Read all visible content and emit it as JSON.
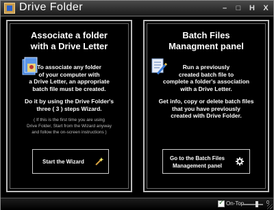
{
  "window": {
    "title": "Drive Folder",
    "controls": [
      "–",
      "□",
      "H",
      "X"
    ]
  },
  "left_panel": {
    "title": "Associate a folder\nwith a Drive Letter",
    "icon": "folder-drive-icon",
    "body": "To associate any folder\nof your computer with\na Drive Letter, an appropriate\nbatch file must be created.",
    "body2": "Do it by using the Drive Folder's\nthree ( 3 ) steps Wizard.",
    "note": "( If this is the first time you are using\nDrive Folder, Start from the Wizard anyway\nand follow the on-screen instructions )",
    "button_label": "Start  the Wizard",
    "button_icon": "magic-wand-icon"
  },
  "right_panel": {
    "title": "Batch Files\nManagment panel",
    "icon": "batch-edit-icon",
    "body": "Run a previously\ncreated batch file to\ncomplete a folder's association\nwith a Drive Letter.",
    "body2": "Get info, copy or delete batch files\nthat you have previously\ncreated with Drive Folder.",
    "button_label": "Go to the Batch Files\nManagement panel",
    "button_icon": "gear-icon"
  },
  "statusbar": {
    "ontop_label": "On-Top",
    "ontop_checked": true,
    "slider_value": "0"
  }
}
